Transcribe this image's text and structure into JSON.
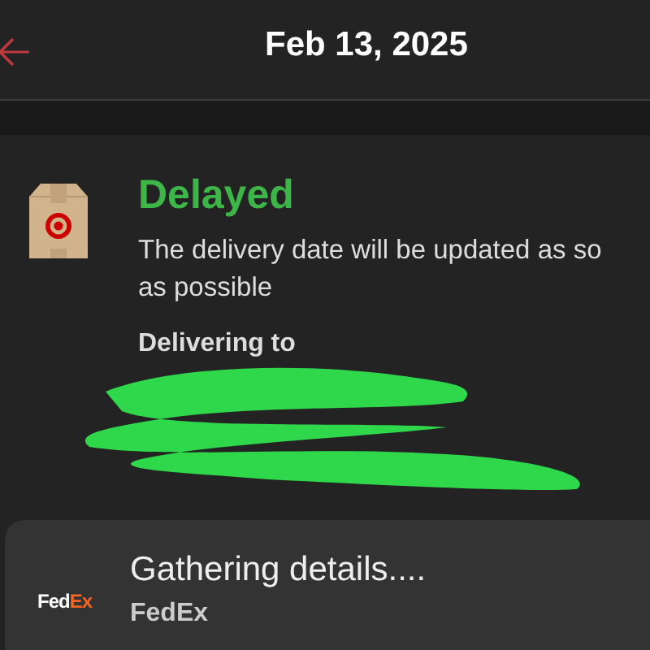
{
  "header": {
    "title": "Feb 13, 2025"
  },
  "status": {
    "label": "Delayed",
    "description_lines": [
      "The delivery date will be updated as so",
      "as possible"
    ]
  },
  "delivery": {
    "heading": "Delivering to"
  },
  "carrier": {
    "logo_parts": [
      "Fed",
      "Ex"
    ],
    "message": "Gathering details....",
    "name": "FedEx"
  }
}
